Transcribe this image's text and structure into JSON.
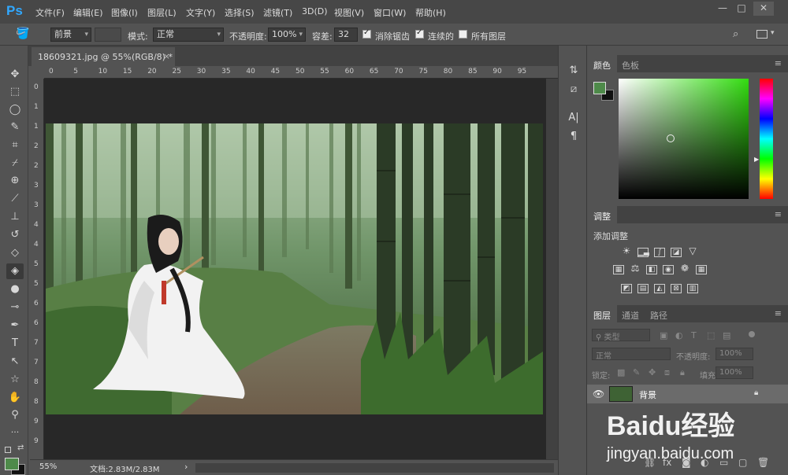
{
  "app": {
    "logo": "Ps"
  },
  "menu": [
    "文件(F)",
    "编辑(E)",
    "图像(I)",
    "图层(L)",
    "文字(Y)",
    "选择(S)",
    "滤镜(T)",
    "3D(D)",
    "视图(V)",
    "窗口(W)",
    "帮助(H)"
  ],
  "window": {
    "min": "—",
    "max": "□",
    "close": "✕"
  },
  "options": {
    "fill_source": "前景",
    "mode_label": "模式:",
    "mode_value": "正常",
    "opacity_label": "不透明度:",
    "opacity_value": "100%",
    "tolerance_label": "容差:",
    "tolerance_value": "32",
    "antialias_label": "消除锯齿",
    "contiguous_label": "连续的",
    "all_layers_label": "所有图层"
  },
  "document": {
    "tab_title": "18609321.jpg @ 55%(RGB/8) *",
    "close": "×",
    "ruler_h": [
      "0",
      "5",
      "10",
      "15",
      "20",
      "25",
      "30",
      "35",
      "40",
      "45",
      "50",
      "55",
      "60",
      "65",
      "70",
      "75",
      "80",
      "85",
      "90",
      "95"
    ],
    "ruler_v": [
      "0",
      "1",
      "1",
      "2",
      "2",
      "3",
      "3",
      "4",
      "4",
      "5",
      "5",
      "6",
      "6",
      "7",
      "7",
      "8",
      "8",
      "9",
      "9"
    ]
  },
  "status": {
    "zoom": "55%",
    "doc_info": "文档:2.83M/2.83M",
    "arrow": "›"
  },
  "colors": {
    "foreground": "#4e8a4a",
    "background": "#111111",
    "picker_hue": "#33dd11"
  },
  "panels": {
    "color": {
      "tab_active": "颜色",
      "tab_other": "色板",
      "menu": "≡"
    },
    "adjustments": {
      "tab": "调整",
      "title": "添加调整",
      "menu": "≡"
    },
    "layers": {
      "tab_active": "图层",
      "tab_channels": "通道",
      "tab_paths": "路径",
      "menu": "≡",
      "filter_kind": "类型",
      "blend_mode": "正常",
      "opacity_label": "不透明度:",
      "opacity_value": "100%",
      "lock_label": "锁定:",
      "fill_label": "填充:",
      "fill_value": "100%",
      "layer_name": "背景"
    }
  },
  "watermark": {
    "brand": "Baidu经验",
    "url": "jingyan.baidu.com"
  }
}
